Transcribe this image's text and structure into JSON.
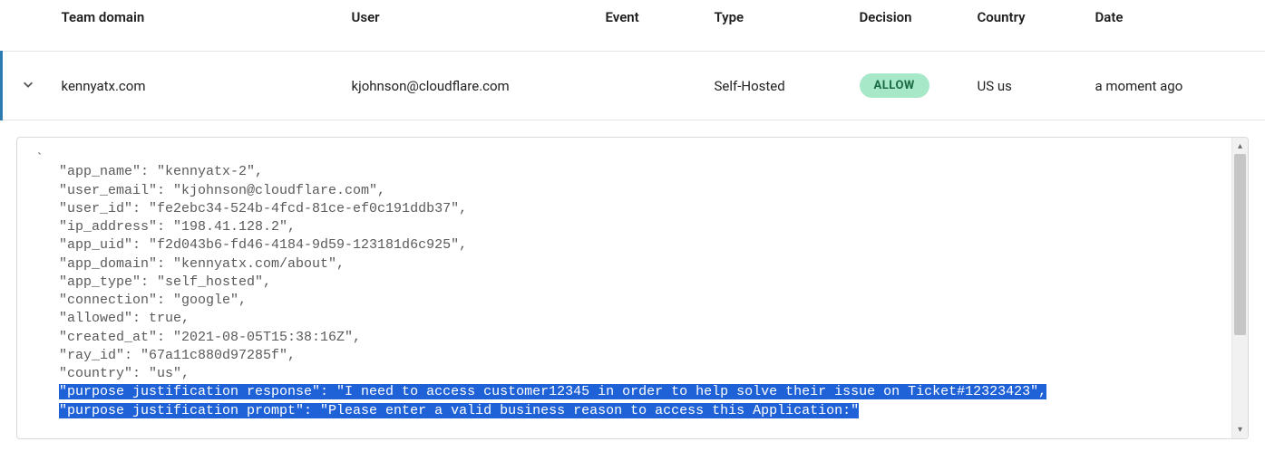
{
  "table": {
    "headers": {
      "team_domain": "Team domain",
      "user": "User",
      "event": "Event",
      "type": "Type",
      "decision": "Decision",
      "country": "Country",
      "date": "Date"
    },
    "row": {
      "team_domain": "kennyatx.com",
      "user": "kjohnson@cloudflare.com",
      "event": "",
      "type": "Self-Hosted",
      "decision": "ALLOW",
      "country": "US us",
      "date": "a moment ago"
    }
  },
  "json_detail": {
    "backtick": "`",
    "lines": [
      {
        "key": "app_name",
        "value": "\"kennyatx-2\",",
        "highlighted": false
      },
      {
        "key": "user_email",
        "value": "\"kjohnson@cloudflare.com\",",
        "highlighted": false
      },
      {
        "key": "user_id",
        "value": "\"fe2ebc34-524b-4fcd-81ce-ef0c191ddb37\",",
        "highlighted": false
      },
      {
        "key": "ip_address",
        "value": "\"198.41.128.2\",",
        "highlighted": false
      },
      {
        "key": "app_uid",
        "value": "\"f2d043b6-fd46-4184-9d59-123181d6c925\",",
        "highlighted": false
      },
      {
        "key": "app_domain",
        "value": "\"kennyatx.com/about\",",
        "highlighted": false
      },
      {
        "key": "app_type",
        "value": "\"self_hosted\",",
        "highlighted": false
      },
      {
        "key": "connection",
        "value": "\"google\",",
        "highlighted": false
      },
      {
        "key": "allowed",
        "value": "true,",
        "highlighted": false
      },
      {
        "key": "created_at",
        "value": "\"2021-08-05T15:38:16Z\",",
        "highlighted": false
      },
      {
        "key": "ray_id",
        "value": "\"67a11c880d97285f\",",
        "highlighted": false
      },
      {
        "key": "country",
        "value": "\"us\",",
        "highlighted": false
      },
      {
        "key": "purpose justification response",
        "value": "\"I need to access customer12345 in order to help solve their issue on Ticket#12323423\",",
        "highlighted": true
      },
      {
        "key": "purpose justification prompt",
        "value": "\"Please enter a valid business reason to access this Application:\"",
        "highlighted": true
      }
    ]
  }
}
